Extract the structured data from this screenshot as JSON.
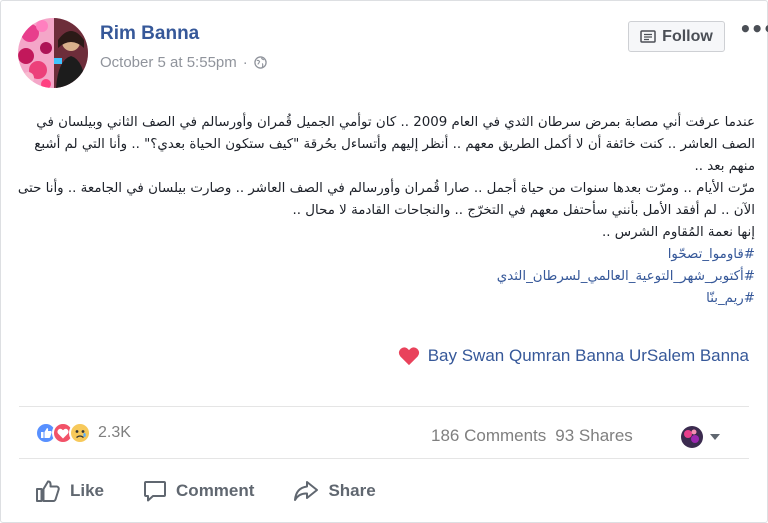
{
  "post": {
    "author": "Rim Banna",
    "timestamp": "October 5 at 5:55pm",
    "separator": "·",
    "audience_icon": "globe-icon",
    "follow_label": "Follow",
    "more_icon": "ellipsis-icon",
    "paragraphs": [
      "عندما عرفت أني مصابة بمرض سرطان الثدي في العام 2009 .. كان توأمي الجميل قُمران وأورسالم في الصف الثاني وبيلسان في الصف العاشر .. كنت خائفة أن لا أكمل الطريق معهم .. أنظر إليهم وأتساءل بحُرقة \"كيف ستكون الحياة بعدي؟\" .. وأنا التي لم أشبع منهم بعد ..",
      "مرّت الأيام .. ومرّت بعدها سنوات من حياة أجمل .. صارا قُمران وأورسالم في الصف العاشر .. وصارت بيلسان في الجامعة .. وأنا حتى الآن .. لم أفقد الأمل بأنني سأحتفل معهم في التخرّج .. والنجاحات القادمة لا محال ..",
      "إنها نعمة المُقاوم الشرس .."
    ],
    "hashtags": [
      "#قاوموا_تصحّوا",
      "#أكتوبر_شهر_التوعية_العالمي_لسرطان_الثدي",
      "#ريم_بنّا"
    ],
    "tagged_text": "Bay Swan Qumran Banna UrSalem Banna",
    "tagged_icon": "heart-icon"
  },
  "stats": {
    "reactions_count": "2.3K",
    "reaction_icons": [
      "like-icon",
      "love-icon",
      "sad-icon"
    ],
    "comments": "186 Comments",
    "shares": "93 Shares"
  },
  "actions": {
    "like": "Like",
    "comment": "Comment",
    "share": "Share"
  },
  "colors": {
    "link": "#365899",
    "like": "#5890ff",
    "love": "#f25268",
    "sad": "#f7c95b",
    "heart": "#e9425b"
  }
}
